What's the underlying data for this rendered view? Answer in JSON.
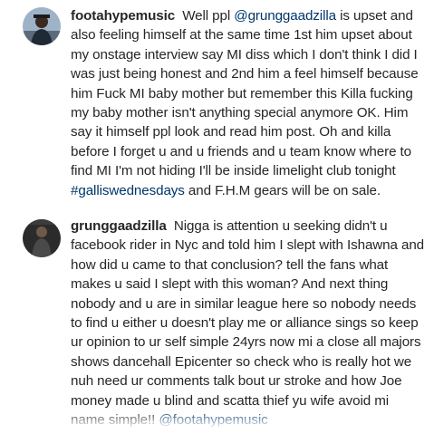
{
  "comments": [
    {
      "username": "footahypemusic",
      "segments": [
        {
          "type": "text",
          "value": "Well ppl "
        },
        {
          "type": "mention",
          "value": "@grunggaadzilla"
        },
        {
          "type": "text",
          "value": " is upset and also feeling himself at the same time 1st him upset about my onstage interview say MI diss which I don't think I did I was just being honest and 2nd him a feel himself because him Fuck MI baby mother but remember this Killa fucking my baby mother isn't anything special anymore OK.  Him say it himself ppl look and read him post.  Oh and killa before I forget u and u friends and u team know where to find MI I'm not hiding I'll be inside limelight club tonight "
        },
        {
          "type": "hashtag",
          "value": "#galliswednesdays"
        },
        {
          "type": "text",
          "value": " and F.H.M gears will be on sale."
        }
      ],
      "timestamp": ""
    },
    {
      "username": "grunggaadzilla",
      "segments": [
        {
          "type": "text",
          "value": "Nigga is attention u seeking didn't u facebook rider in Nyc and told him I slept with Ishawna and how did u came to that conclusion? tell the fans what makes u said I slept with this woman? And next thing nobody and u are in similar league here so nobody needs to find u either u doesn't play me or alliance sings so keep ur opinion to ur self simple 24yrs now mi a close all majors shows dancehall Epicenter so check who is really hot we nuh need ur comments talk bout ur stroke and how Joe money made u blind and scatta thief yu wife avoid mi name simple!! "
        },
        {
          "type": "mention",
          "value": "@footahypemusic"
        }
      ],
      "timestamp": ""
    }
  ],
  "colors": {
    "text": "#262626",
    "link": "#003569",
    "timestamp": "#a8a8a8",
    "background": "#ffffff"
  },
  "icons": [
    "avatar-footahypemusic",
    "avatar-grunggaadzilla"
  ]
}
